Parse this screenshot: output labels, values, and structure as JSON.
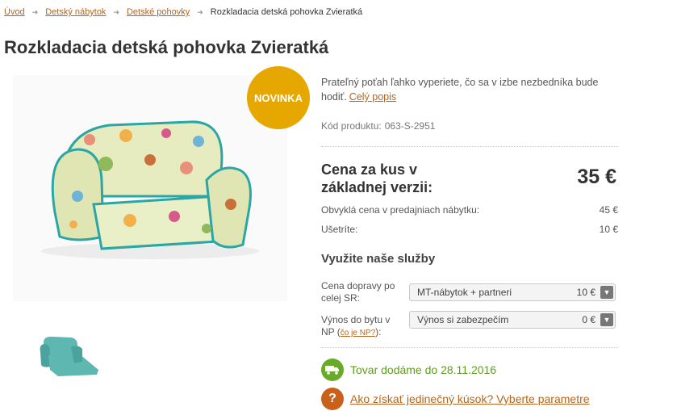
{
  "breadcrumb": {
    "items": [
      "Úvod",
      "Detský nábytok",
      "Detské pohovky"
    ],
    "current": "Rozkladacia detská pohovka Zvieratká"
  },
  "product": {
    "title": "Rozkladacia detská pohovka Zvieratká",
    "badge": "NOVINKA",
    "description": "Prateľný poťah ľahko vyperiete, čo sa v izbe nezbedníka bude hodiť.",
    "full_description_link": "Celý popis",
    "code_label": "Kód produktu:",
    "code_value": "063-S-2951"
  },
  "pricing": {
    "label": "Cena za kus v základnej verzii:",
    "value": "35 €",
    "usual_label": "Obvyklá cena v predajniach nábytku:",
    "usual_value": "45 €",
    "savings_label": "Ušetríte:",
    "savings_value": "10 €"
  },
  "services": {
    "title": "Využite naše služby",
    "delivery_label": "Cena dopravy po celej SR:",
    "delivery_option": "MT-nábytok + partneri",
    "delivery_price": "10 €",
    "carry_label": "Výnos do bytu v NP",
    "carry_link": "čo je NP?",
    "carry_option": "Výnos si zabezpečím",
    "carry_price": "0 €"
  },
  "delivery_info": {
    "text": "Tovar dodáme do 28.11.2016",
    "unique_link": "Ako získať jedinečný kúsok? Vyberte parametre"
  },
  "colors": {
    "accent_link": "#b5651d",
    "badge": "#e5a700",
    "delivery_green": "#6aaa2a",
    "question_orange": "#c9611b",
    "sofa_fabric": "#e6ecc0",
    "sofa_piping": "#2aa6a4",
    "thumb_teal": "#5fb7b2"
  },
  "icons": [
    "chevron-right-icon",
    "truck-icon",
    "question-icon",
    "select-arrow-icon"
  ]
}
